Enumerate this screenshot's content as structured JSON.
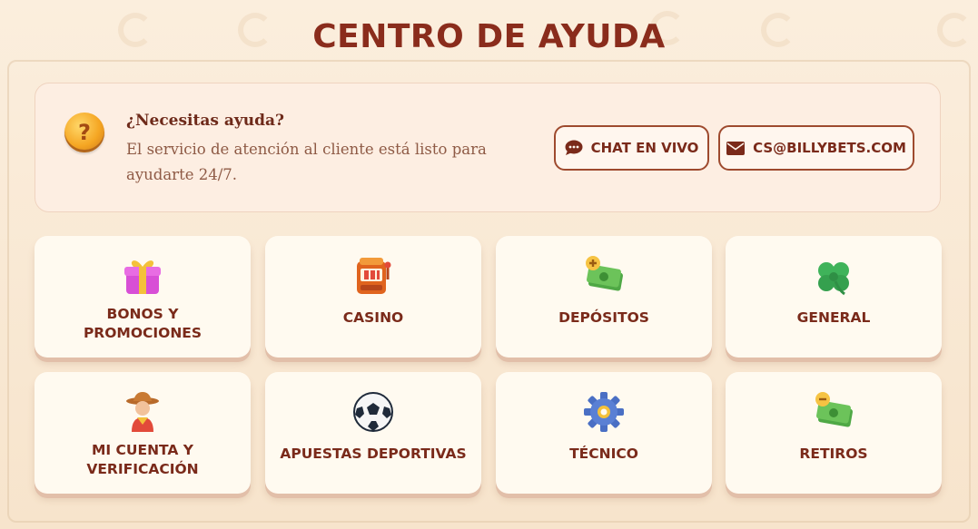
{
  "page_title": "CENTRO DE AYUDA",
  "help": {
    "title": "¿Necesitas ayuda?",
    "description": "El servicio de atención al cliente está listo para ayudarte 24/7.",
    "chat_label": "CHAT EN VIVO",
    "email_label": "CS@BILLYBETS.COM"
  },
  "categories": [
    {
      "label": "BONOS Y PROMOCIONES",
      "icon": "gift-icon"
    },
    {
      "label": "CASINO",
      "icon": "slot-machine-icon"
    },
    {
      "label": "DEPÓSITOS",
      "icon": "money-plus-icon"
    },
    {
      "label": "GENERAL",
      "icon": "clover-icon"
    },
    {
      "label": "MI CUENTA Y VERIFICACIÓN",
      "icon": "cowboy-avatar-icon"
    },
    {
      "label": "APUESTAS DEPORTIVAS",
      "icon": "soccer-ball-icon"
    },
    {
      "label": "TÉCNICO",
      "icon": "gear-icon"
    },
    {
      "label": "RETIROS",
      "icon": "money-minus-icon"
    }
  ],
  "colors": {
    "title": "#8a2c1c",
    "accent_border": "#9e4a2e",
    "background": "#fbeedd",
    "card": "#fffaf0"
  }
}
